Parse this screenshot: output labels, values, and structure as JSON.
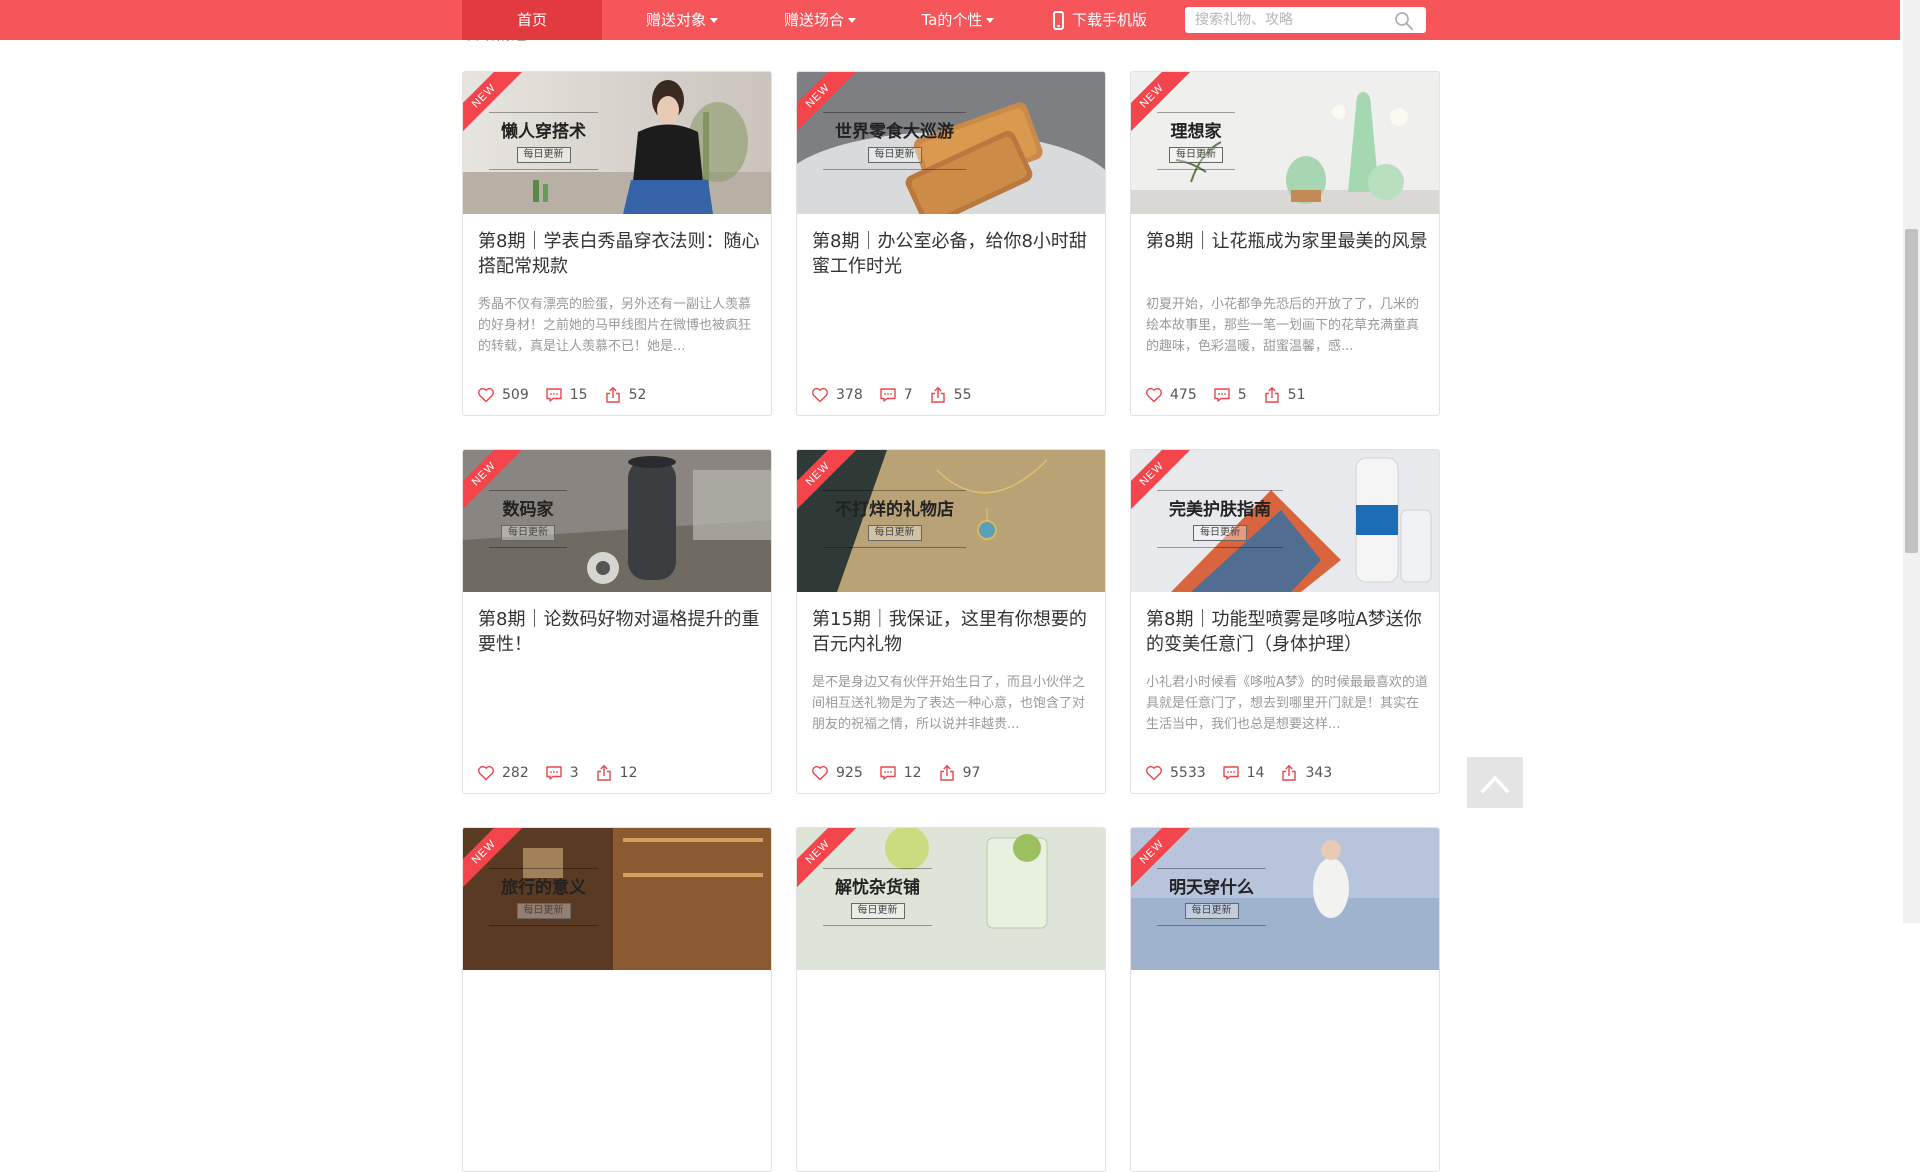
{
  "nav": {
    "items": [
      {
        "label": "首页",
        "active": true
      },
      {
        "label": "赠送对象",
        "dropdown": true
      },
      {
        "label": "赠送场合",
        "dropdown": true
      },
      {
        "label": "Ta的个性",
        "dropdown": true
      }
    ],
    "download_label": "下载手机版",
    "search_placeholder": "搜索礼物、攻略"
  },
  "section_label": "攻略精选",
  "cards": [
    {
      "badge": "NEW",
      "column": "懒人穿搭术",
      "column_sub": "每日更新",
      "title": "第8期｜学表白秀晶穿衣法则：随心搭配常规款",
      "desc": "秀晶不仅有漂亮的脸蛋，另外还有一副让人羡慕的好身材！之前她的马甲线图片在微博也被疯狂的转载，真是让人羡慕不已！她是...",
      "likes": "509",
      "comments": "15",
      "shares": "52"
    },
    {
      "badge": "NEW",
      "column": "世界零食大巡游",
      "column_sub": "每日更新",
      "title": "第8期｜办公室必备，给你8小时甜蜜工作时光",
      "desc": "",
      "likes": "378",
      "comments": "7",
      "shares": "55"
    },
    {
      "badge": "NEW",
      "column": "理想家",
      "column_sub": "每日更新",
      "title": "第8期｜让花瓶成为家里最美的风景",
      "desc": "初夏开始，小花都争先恐后的开放了了，几米的绘本故事里，那些一笔一划画下的花草充满童真的趣味，色彩温暖，甜蜜温馨，感...",
      "likes": "475",
      "comments": "5",
      "shares": "51"
    },
    {
      "badge": "NEW",
      "column": "数码家",
      "column_sub": "每日更新",
      "title": "第8期｜论数码好物对逼格提升的重要性！",
      "desc": "",
      "likes": "282",
      "comments": "3",
      "shares": "12"
    },
    {
      "badge": "NEW",
      "column": "不打烊的礼物店",
      "column_sub": "每日更新",
      "title": "第15期｜我保证，这里有你想要的百元内礼物",
      "desc": "是不是身边又有伙伴开始生日了，而且小伙伴之间相互送礼物是为了表达一种心意，也饱含了对朋友的祝福之情，所以说并非越贵...",
      "likes": "925",
      "comments": "12",
      "shares": "97"
    },
    {
      "badge": "NEW",
      "column": "完美护肤指南",
      "column_sub": "每日更新",
      "title": "第8期｜功能型喷雾是哆啦A梦送你的变美任意门（身体护理）",
      "desc": "小礼君小时候看《哆啦A梦》的时候最最喜欢的道具就是任意门了，想去到哪里开门就是！其实在生活当中，我们也总是想要这样...",
      "likes": "5533",
      "comments": "14",
      "shares": "343"
    },
    {
      "badge": "NEW",
      "column": "旅行的意义",
      "column_sub": "每日更新",
      "title": "",
      "desc": "",
      "likes": "",
      "comments": "",
      "shares": ""
    },
    {
      "badge": "NEW",
      "column": "解忧杂货铺",
      "column_sub": "每日更新",
      "title": "",
      "desc": "",
      "likes": "",
      "comments": "",
      "shares": ""
    },
    {
      "badge": "NEW",
      "column": "明天穿什么",
      "column_sub": "每日更新",
      "title": "",
      "desc": "",
      "likes": "",
      "comments": "",
      "shares": ""
    }
  ],
  "icons": {
    "like": "heart-icon",
    "comment": "comment-icon",
    "share": "share-icon",
    "back_to_top": "chevron-up-icon",
    "search": "search-icon",
    "download": "phone-icon"
  },
  "colors": {
    "nav_bg": "#f6555a",
    "nav_active": "#e33a40",
    "ribbon": "#f3454b",
    "icon_red": "#e8464c"
  }
}
